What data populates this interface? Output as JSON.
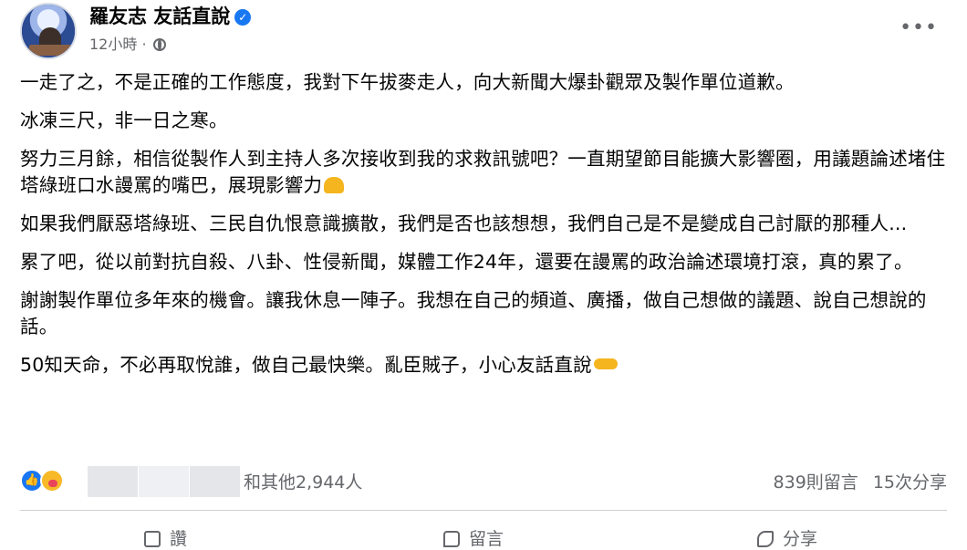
{
  "post": {
    "author": "羅友志 友話直說",
    "time": "12小時",
    "separator": "·",
    "more": "•••",
    "verified_icon": "verified-check-icon",
    "paragraphs": [
      "一走了之，不是正確的工作態度，我對下午拔麥走人，向大新聞大爆卦觀眾及製作單位道歉。",
      "冰凍三尺，非一日之寒。",
      "努力三月餘，相信從製作人到主持人多次接收到我的求救訊號吧？一直期望節目能擴大影響圈，用議題論述堵住塔綠班口水謾罵的嘴巴，展現影響力",
      "如果我們厭惡塔綠班、三民自仇恨意識擴散，我們是否也該想想，我們自己是不是變成自己討厭的那種人...",
      "累了吧，從以前對抗自殺、八卦、性侵新聞，媒體工作24年，還要在謾罵的政治論述環境打滾，真的累了。",
      "謝謝製作單位多年來的機會。讓我休息一陣子。我想在自己的頻道、廣播，做自己想做的議題、說自己想說的話。",
      "50知天命，不必再取悅誰，做自己最快樂。亂臣賊子，小心友話直說"
    ]
  },
  "footer": {
    "reactions_text": "和其他2,944人",
    "comments": "839則留言",
    "shares": "15次分享",
    "like_label": "讚",
    "comment_label": "留言",
    "share_label": "分享"
  },
  "colors": {
    "accent": "#1877f2",
    "secondary_text": "#65676b"
  }
}
